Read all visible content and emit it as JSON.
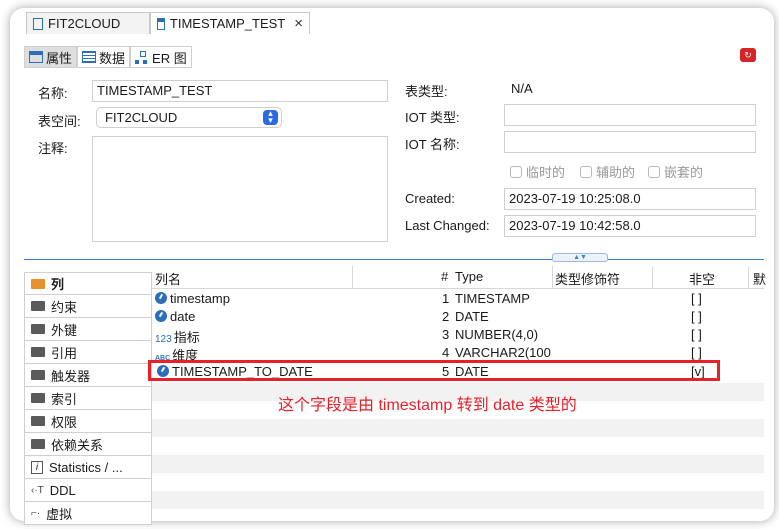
{
  "editor_tabs": [
    {
      "label": "FIT2CLOUD"
    },
    {
      "label": "TIMESTAMP_TEST",
      "close": "×"
    }
  ],
  "sub_tabs": [
    {
      "label": "属性"
    },
    {
      "label": "数据"
    },
    {
      "label": "ER 图"
    }
  ],
  "props": {
    "name_label": "名称:",
    "name_value": "TIMESTAMP_TEST",
    "tablespace_label": "表空间:",
    "tablespace_value": "FIT2CLOUD",
    "comment_label": "注释:",
    "table_type_label": "表类型:",
    "table_type_value": "N/A",
    "iot_type_label": "IOT 类型:",
    "iot_name_label": "IOT 名称:",
    "temporary_label": "临时的",
    "auxiliary_label": "辅助的",
    "nested_label": "嵌套的",
    "created_label": "Created:",
    "created_value": "2023-07-19 10:25:08.0",
    "changed_label": "Last Changed:",
    "changed_value": "2023-07-19 10:42:58.0"
  },
  "side_nav": [
    {
      "label": "列"
    },
    {
      "label": "约束"
    },
    {
      "label": "外键"
    },
    {
      "label": "引用"
    },
    {
      "label": "触发器"
    },
    {
      "label": "索引"
    },
    {
      "label": "权限"
    },
    {
      "label": "依赖关系"
    },
    {
      "label": "Statistics / ..."
    },
    {
      "label": "DDL"
    },
    {
      "label": "虚拟"
    }
  ],
  "columns_table": {
    "headers": {
      "name": "列名",
      "num": "#",
      "type": "Type",
      "modifier": "类型修饰符",
      "notnull": "非空",
      "extra": "默"
    },
    "rows": [
      {
        "name": "timestamp",
        "num": "1",
        "type": "TIMESTAMP",
        "notnull": "[ ]"
      },
      {
        "name": "date",
        "num": "2",
        "type": "DATE",
        "notnull": "[ ]"
      },
      {
        "name": "指标",
        "num": "3",
        "type": "NUMBER(4,0)",
        "notnull": "[ ]"
      },
      {
        "name": "维度",
        "num": "4",
        "type": "VARCHAR2(100",
        "notnull": "[ ]"
      },
      {
        "name": "TIMESTAMP_TO_DATE",
        "num": "5",
        "type": "DATE",
        "notnull": "[v]"
      }
    ]
  },
  "icons": {
    "numeric": "123",
    "text": "ABC"
  },
  "annotation": "这个字段是由 timestamp 转到 date 类型的",
  "colors": {
    "highlight": "#e8202a",
    "accent": "#2d6fb7"
  }
}
